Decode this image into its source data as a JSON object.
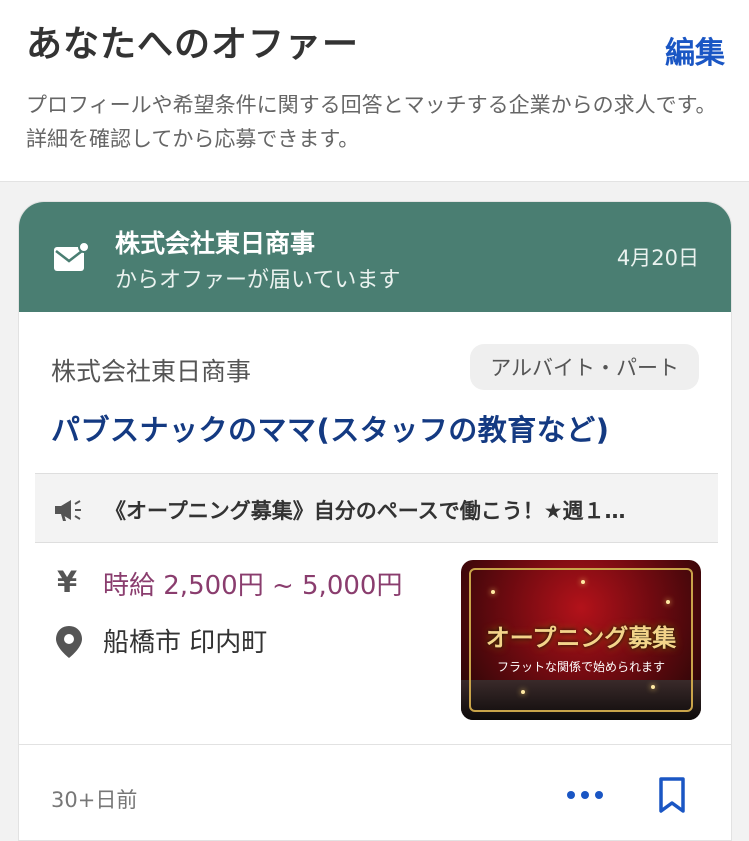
{
  "header": {
    "title": "あなたへのオファー",
    "edit_label": "編集",
    "description": "プロフィールや希望条件に関する回答とマッチする企業からの求人です。詳細を確認してから応募できます。"
  },
  "offer": {
    "company": "株式会社東日商事",
    "message": "からオファーが届いています",
    "date": "4月20日",
    "accent_color": "#4a7e72"
  },
  "job": {
    "company": "株式会社東日商事",
    "type": "アルバイト・パート",
    "title": "パブスナックのママ(スタッフの教育など)",
    "catch": "《オープニング募集》自分のペースで働こう！★週１…",
    "salary": "時給 2,500円 ~ 5,000円",
    "location": "船橋市 印内町",
    "image": {
      "title": "オープニング募集",
      "subtitle": "フラットな関係で始められます"
    },
    "posted": "30+日前"
  },
  "icons": [
    "mail-icon",
    "megaphone-icon",
    "yen-icon",
    "location-pin-icon",
    "more-icon",
    "bookmark-icon"
  ]
}
